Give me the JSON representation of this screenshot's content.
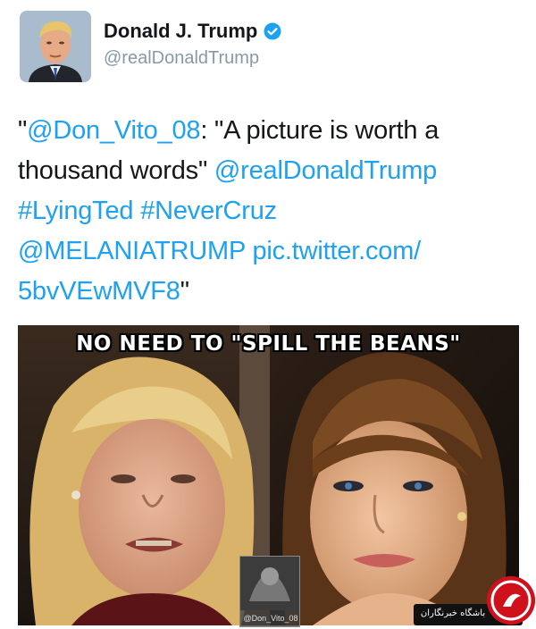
{
  "tweet": {
    "display_name": "Donald J. Trump",
    "handle": "@realDonaldTrump",
    "verified": true,
    "avatar_icon": "profile-photo",
    "text_lines": [
      [
        {
          "text": "\"",
          "link": false
        },
        {
          "text": "@Don_Vito_08",
          "link": true
        },
        {
          "text": ": \"A picture is worth a",
          "link": false
        }
      ],
      [
        {
          "text": "thousand words\" ",
          "link": false
        },
        {
          "text": "@realDonaldTrump",
          "link": true
        }
      ],
      [
        {
          "text": "#LyingTed",
          "link": true
        },
        {
          "text": " ",
          "link": false
        },
        {
          "text": "#NeverCruz",
          "link": true
        }
      ],
      [
        {
          "text": "@MELANIATRUMP",
          "link": true
        },
        {
          "text": " ",
          "link": false
        },
        {
          "text": "pic.twitter.com/",
          "link": true
        }
      ],
      [
        {
          "text": "5bvVEwMVF8",
          "link": true
        },
        {
          "text": "\"",
          "link": false
        }
      ]
    ]
  },
  "media": {
    "caption": "NO NEED TO \"SPILL THE BEANS\"",
    "credit": "@Don_Vito_08"
  },
  "watermark": {
    "site_text": "باشگاه خبرنگاران"
  },
  "colors": {
    "link": "#1da1f2",
    "text": "#14171a",
    "handle": "#8899a6",
    "verified": "#1da1f2",
    "news_logo": "#d0101a"
  }
}
